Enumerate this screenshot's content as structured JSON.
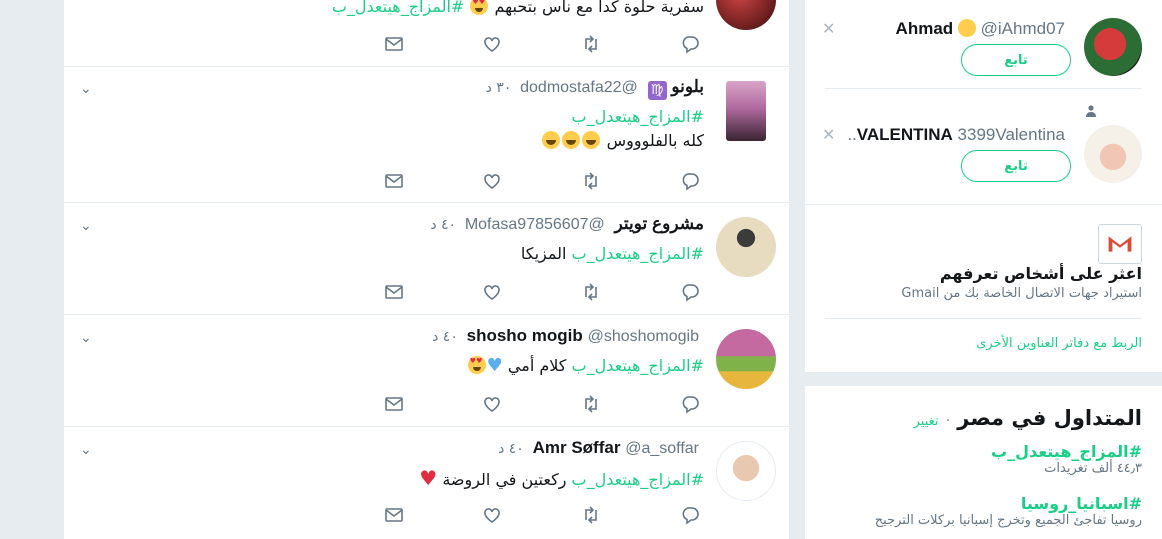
{
  "feed": {
    "tweets": [
      {
        "name": "",
        "handle": "",
        "time": "",
        "lines": [
          "سفرية حلوة كدا مع ناس بتحبهم",
          "#المزاج_هيتعدل_ب"
        ]
      },
      {
        "name": "بلونو",
        "handle": "@dodmostafa22",
        "time": "٣٠ د",
        "hashtag": "#المزاج_هيتعدل_ب",
        "text": "كله بالفلوووس",
        "sign": "♍"
      },
      {
        "name": "مشروع تويتر",
        "handle": "@Mofasa97856607",
        "time": "٤٠ د",
        "hashtag": "#المزاج_هيتعدل_ب",
        "text": "المزيكا"
      },
      {
        "name": "shosho mogib",
        "handle": "@shoshomogib",
        "time": "٤٠ د",
        "hashtag": "#المزاج_هيتعدل_ب",
        "text": "كلام أمي"
      },
      {
        "name": "Amr Søffar",
        "handle": "@a_soffar",
        "time": "٤٠ د",
        "hashtag": "#المزاج_هيتعدل_ب",
        "text": "ركعتين في الروضة"
      }
    ]
  },
  "who_to_follow": {
    "users": [
      {
        "name": "Ahmad",
        "handle": "@iAhmd07",
        "follow_label": "تابع"
      },
      {
        "name": "VALENTINA",
        "handle": "3399Valentina..",
        "follow_label": "تابع"
      }
    ],
    "find_title": "اعثر على أشخاص تعرفهم",
    "find_sub": "استيراد جهات الاتصال الخاصة بك من Gmail",
    "connect_link": "الربط مع دفاتر العناوين الأخرى"
  },
  "trends": {
    "title": "المتداول في مصر",
    "dot": "·",
    "change": "تغيير",
    "items": [
      {
        "name": "#المزاج_هيتعدل_ب",
        "meta": "٤٤٫٣ ألف تغريدات"
      },
      {
        "name": "#اسبانيا_روسيا",
        "meta": "روسيا تفاجئ الجميع وتخرج إسبانيا بركلات الترجيح"
      }
    ]
  },
  "colors": {
    "accent": "#19cf86",
    "text_secondary": "#657786",
    "background": "#e6ecf0"
  },
  "icons": [
    "chevron-down-icon",
    "reply-icon",
    "retweet-icon",
    "like-icon",
    "message-icon",
    "close-icon",
    "person-icon",
    "gmail-icon"
  ]
}
